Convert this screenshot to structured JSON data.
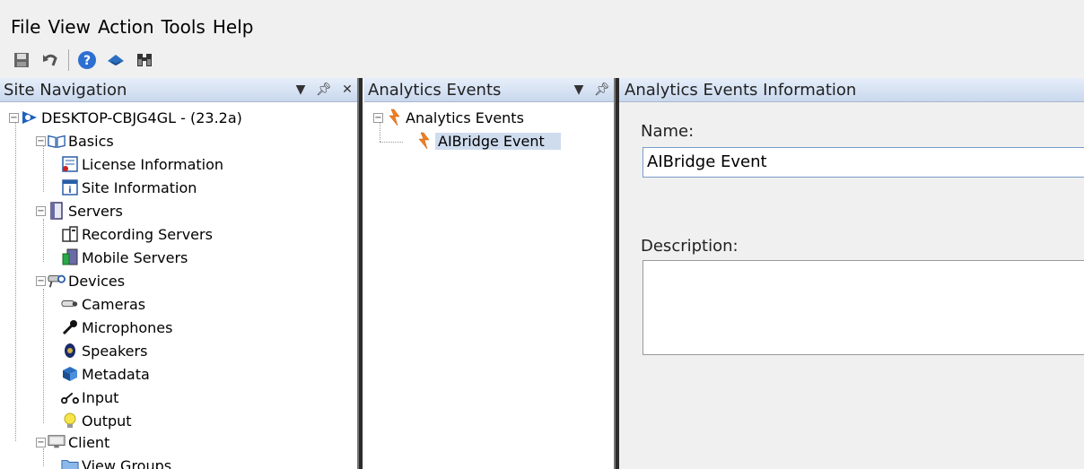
{
  "menu": [
    "File",
    "View",
    "Action",
    "Tools",
    "Help"
  ],
  "toolbar": {
    "icons": [
      "save-icon",
      "undo-icon",
      "help-icon",
      "tools-icon",
      "binoculars-icon"
    ]
  },
  "site_nav": {
    "title": "Site Navigation",
    "tree": {
      "root": "DESKTOP-CBJG4GL - (23.2a)",
      "basics": "Basics",
      "license": "License Information",
      "site_info": "Site Information",
      "servers": "Servers",
      "recording": "Recording Servers",
      "mobile": "Mobile Servers",
      "devices": "Devices",
      "cameras": "Cameras",
      "microphones": "Microphones",
      "speakers": "Speakers",
      "metadata": "Metadata",
      "input": "Input",
      "output": "Output",
      "client": "Client",
      "view_groups": "View Groups"
    }
  },
  "analytics_events": {
    "title": "Analytics Events",
    "root": "Analytics Events",
    "child": "AIBridge Event"
  },
  "info": {
    "title": "Analytics Events Information",
    "name_label": "Name:",
    "name_value": "AIBridge Event",
    "description_label": "Description:",
    "description_value": ""
  },
  "colors": {
    "header_gradient_top": "#e6eef9",
    "header_gradient_bottom": "#c9d8ee",
    "selection": "#cfdcee",
    "splitter": "#2b2b2b"
  }
}
